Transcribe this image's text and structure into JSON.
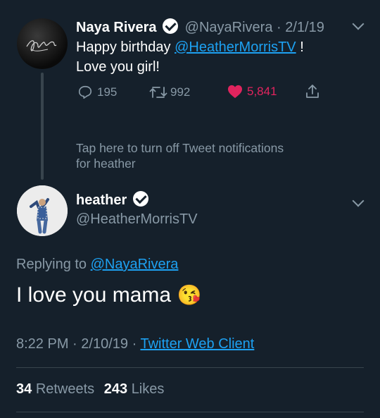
{
  "parent_tweet": {
    "display_name": "Naya Rivera",
    "handle": "@NayaRivera",
    "separator": "·",
    "date": "2/1/19",
    "text_pre": "Happy birthday ",
    "mention": "@HeatherMorrisTV",
    "text_post": " !",
    "text_line2": "Love you girl!",
    "reply_count": "195",
    "retweet_count": "992",
    "like_count": "5,841",
    "avatar_signature": "NRivera"
  },
  "notification": {
    "line1": "Tap here to turn off Tweet notifications",
    "line2": "for heather"
  },
  "main_tweet": {
    "display_name": "heather",
    "handle": "@HeatherMorrisTV",
    "replying_to_label": "Replying to",
    "replying_to_handle": "@NayaRivera",
    "text": "I love you mama",
    "emoji": "😘",
    "time": "8:22 PM",
    "dot": "·",
    "date": "2/10/19",
    "source": "Twitter Web Client",
    "retweets_count": "34",
    "retweets_label": "Retweets",
    "likes_count": "243",
    "likes_label": "Likes"
  },
  "colors": {
    "background": "#15202b",
    "accent": "#1da1f2",
    "like": "#e0245e",
    "muted": "#8899a6"
  }
}
